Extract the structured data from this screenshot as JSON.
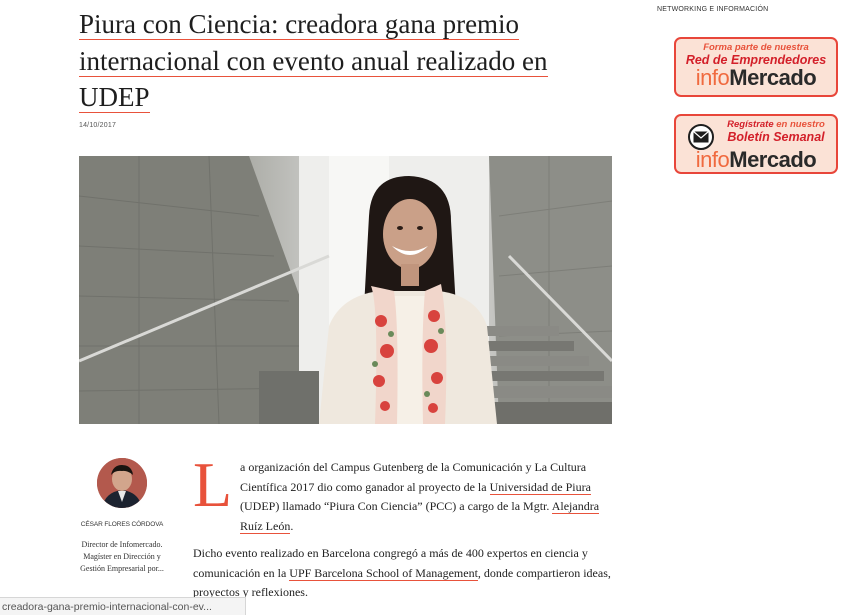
{
  "article": {
    "title_l1": "Piura con Ciencia: creadora gana premio",
    "title_l2": "internacional con evento anual realizado en",
    "title_l3": "UDEP",
    "date": "14/10/2017"
  },
  "author": {
    "name": "CÉSAR FLORES CÓRDOVA",
    "bio": "Director de Infomercado. Magíster en Dirección y Gestión Empresarial por..."
  },
  "body": {
    "dropcap": "L",
    "p1_a": "a organización del Campus Gutenberg de la Comunicación y La Cultura Científica 2017 dio como ganador al proyecto de la ",
    "p1_link1": "Universidad de Piura",
    "p1_b": " (UDEP) llamado “Piura Con Ciencia” (PCC) a cargo de la Mgtr. ",
    "p1_link2": "Alejandra Ruíz León",
    "p1_c": ".",
    "p2_a": "Dicho evento realizado en Barcelona congregó a más de 400 expertos en ciencia y comunicación en la ",
    "p2_link": "UPF Barcelona School of Management",
    "p2_b": ", donde compartieron ideas, proyectos y reflexiones."
  },
  "sidebar": {
    "section_label": "NETWORKING E INFORMACIÓN",
    "promo1": {
      "line1": "Forma parte de nuestra",
      "line2": "Red de Emprendedores",
      "brand_info": "info",
      "brand_merc": "Mercado"
    },
    "promo2": {
      "line1_a": "Regístrate",
      "line1_b": " en nuestro",
      "line2": "Boletín Semanal",
      "brand_info": "info",
      "brand_merc": "Mercado",
      "icon": "envelope-icon"
    }
  },
  "status_bar": {
    "url": "creadora-gana-premio-internacional-con-ev..."
  },
  "colors": {
    "accent": "#e8523b",
    "promo_border": "#e8463a",
    "promo_bg": "#fbe2d6"
  }
}
